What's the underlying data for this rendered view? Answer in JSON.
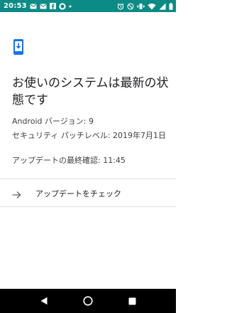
{
  "status_bar": {
    "time": "20:53",
    "left_icons": [
      "mail-icon",
      "mail-icon",
      "facebook-icon",
      "shield-icon",
      "dot-icon"
    ],
    "right_icons": [
      "alarm-icon",
      "do-not-disturb-icon",
      "vibrate-icon",
      "wifi-icon",
      "signal-icon",
      "battery-icon"
    ],
    "background": "#0c8a85"
  },
  "header": {
    "icon": "system-update-phone-icon",
    "accent": "#1a73e8",
    "title": "お使いのシステムは最新の状態です"
  },
  "info": {
    "android_version": "Android バージョン: 9",
    "security_patch": "セキュリティ パッチレベル: 2019年7月1日",
    "last_check": "アップデートの最終確認: 11:45"
  },
  "action": {
    "icon": "arrow-right-icon",
    "label": "アップデートをチェック"
  },
  "nav_bar": {
    "icons": [
      "back-icon",
      "home-icon",
      "recents-icon"
    ]
  }
}
